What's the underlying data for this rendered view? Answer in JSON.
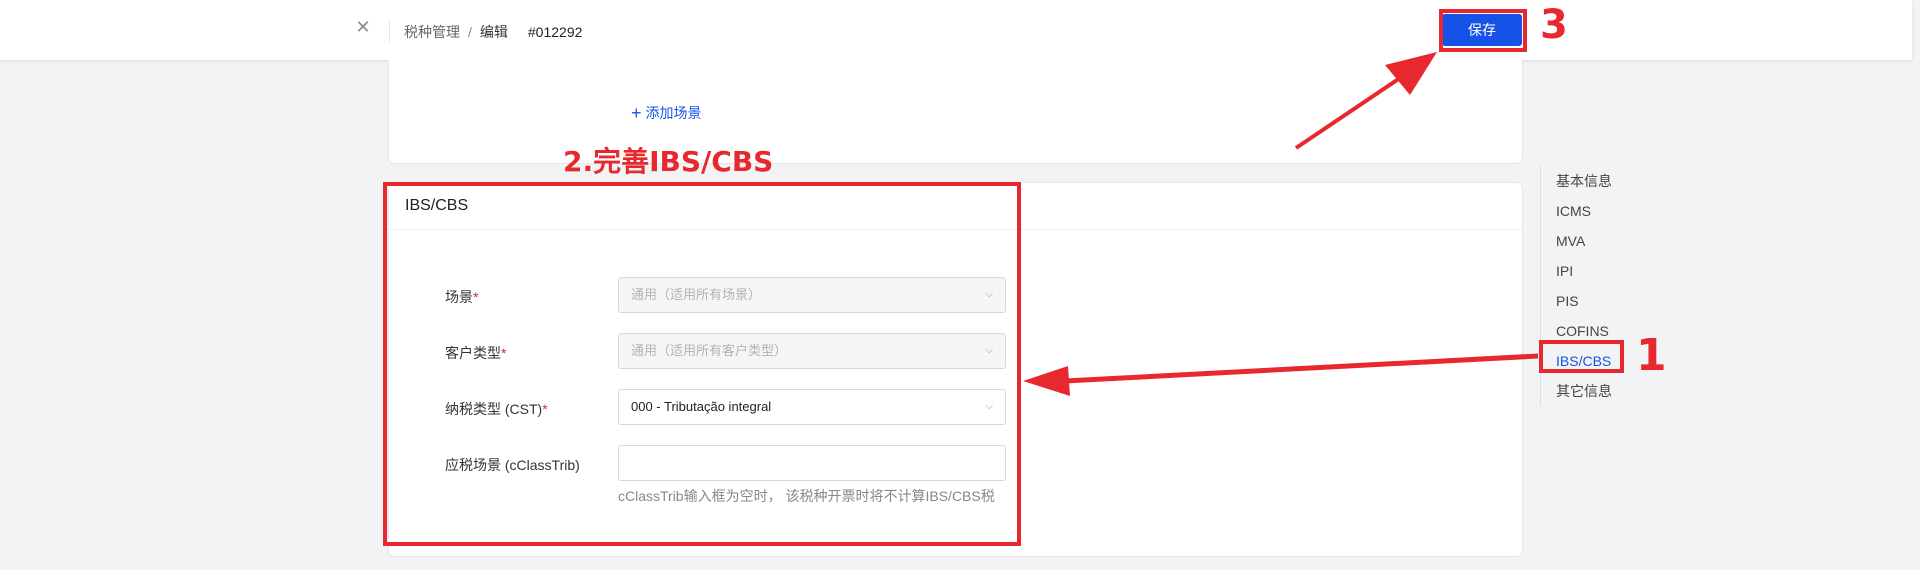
{
  "topbar": {
    "close_icon": "close-icon",
    "breadcrumb": {
      "parent": "税种管理",
      "separator": "/",
      "current": "编辑",
      "code": "#012292"
    },
    "save_label": "保存"
  },
  "scene_card": {
    "add_scene_label": "添加场景",
    "add_icon": "plus-icon"
  },
  "ibs_section": {
    "title": "IBS/CBS",
    "fields": {
      "scene": {
        "label": "场景",
        "required": "*",
        "value": "通用（适用所有场景）",
        "disabled": true
      },
      "customer_type": {
        "label": "客户类型",
        "required": "*",
        "value": "通用（适用所有客户类型）",
        "disabled": true
      },
      "tax_type": {
        "label": "纳税类型 (CST)",
        "required": "*",
        "value": "000 - Tributação integral",
        "disabled": false
      },
      "cclasstrib": {
        "label": "应税场景 (cClassTrib)",
        "value": "",
        "hint": "cClassTrib输入框为空时， 该税种开票时将不计算IBS/CBS税"
      }
    }
  },
  "anchor_nav": {
    "items": [
      "基本信息",
      "ICMS",
      "MVA",
      "IPI",
      "PIS",
      "COFINS",
      "IBS/CBS",
      "其它信息"
    ],
    "active": "IBS/CBS"
  },
  "annotations": {
    "step1": "1",
    "step2": "2.完善IBS/CBS",
    "step3": "3",
    "color": "#e8282f"
  }
}
